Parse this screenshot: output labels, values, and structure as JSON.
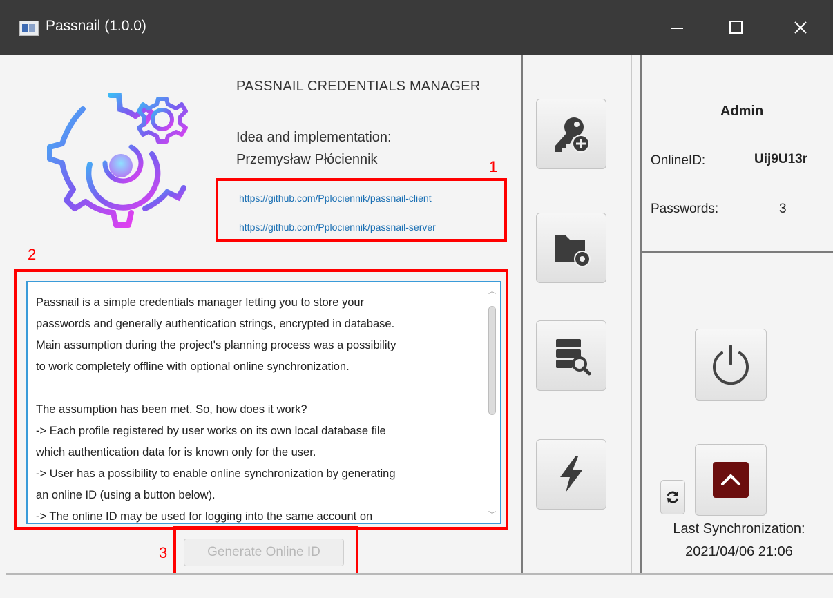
{
  "window": {
    "title": "Passnail (1.0.0)"
  },
  "about": {
    "heading": "PASSNAIL CREDENTIALS MANAGER",
    "idea_line1": "Idea and implementation:",
    "idea_line2": "Przemysław Płóciennik",
    "link_client": "https://github.com/Pplociennik/passnail-client",
    "link_server": "https://github.com/Pplociennik/passnail-server"
  },
  "description": "Passnail is a simple credentials manager letting you to store your\npasswords and generally authentication strings, encrypted in database.\nMain assumption during the project's planning process was a possibility\nto work completely offline with optional online synchronization.\n\nThe assumption has been met. So, how does it work?\n-> Each profile registered by user works on its own local database file\nwhich authentication data for is known only for the user.\n-> User has a possibility to enable online synchronization by generating\nan online ID (using a button below).\n-> The online ID may be used for logging into the same account on\nanother device and downloading the data from the cloud.",
  "generate_button": "Generate Online ID",
  "annotations": {
    "a1": "1",
    "a2": "2",
    "a3": "3"
  },
  "user": {
    "name": "Admin",
    "online_id_label": "OnlineID:",
    "online_id_value": "Uij9U13r",
    "passwords_label": "Passwords:",
    "passwords_value": "3"
  },
  "sync": {
    "label": "Last Synchronization:",
    "datetime": "2021/04/06 21:06"
  },
  "toolbar_icons": [
    "add-key-icon",
    "folder-settings-icon",
    "database-search-icon",
    "lightning-icon"
  ],
  "colors": {
    "annotation_red": "#ff0000",
    "link_blue": "#1a6fb3",
    "dark_red_button": "#6b0e0e",
    "textarea_focus": "#3a9bd9"
  }
}
